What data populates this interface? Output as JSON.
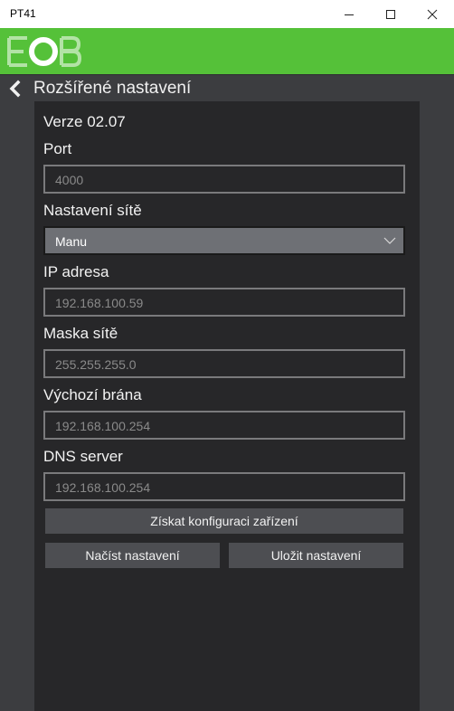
{
  "window": {
    "title": "PT41"
  },
  "header": {
    "title": "Rozšířené nastavení"
  },
  "version": {
    "label": "Verze",
    "value": "02.07"
  },
  "fields": {
    "port": {
      "label": "Port",
      "value": "4000"
    },
    "network_mode": {
      "label": "Nastavení sítě",
      "value": "Manu"
    },
    "ip": {
      "label": "IP adresa",
      "value": "192.168.100.59"
    },
    "mask": {
      "label": "Maska sítě",
      "value": "255.255.255.0"
    },
    "gateway": {
      "label": "Výchozí brána",
      "value": "192.168.100.254"
    },
    "dns": {
      "label": "DNS server",
      "value": "192.168.100.254"
    }
  },
  "buttons": {
    "get_config": "Získat konfiguraci zařízení",
    "load": "Načíst nastavení",
    "save": "Uložit nastavení"
  },
  "colors": {
    "brand_green": "#55c139",
    "panel_dark": "#272729",
    "sidebar": "#3c3d40",
    "button": "#4d4e52"
  }
}
